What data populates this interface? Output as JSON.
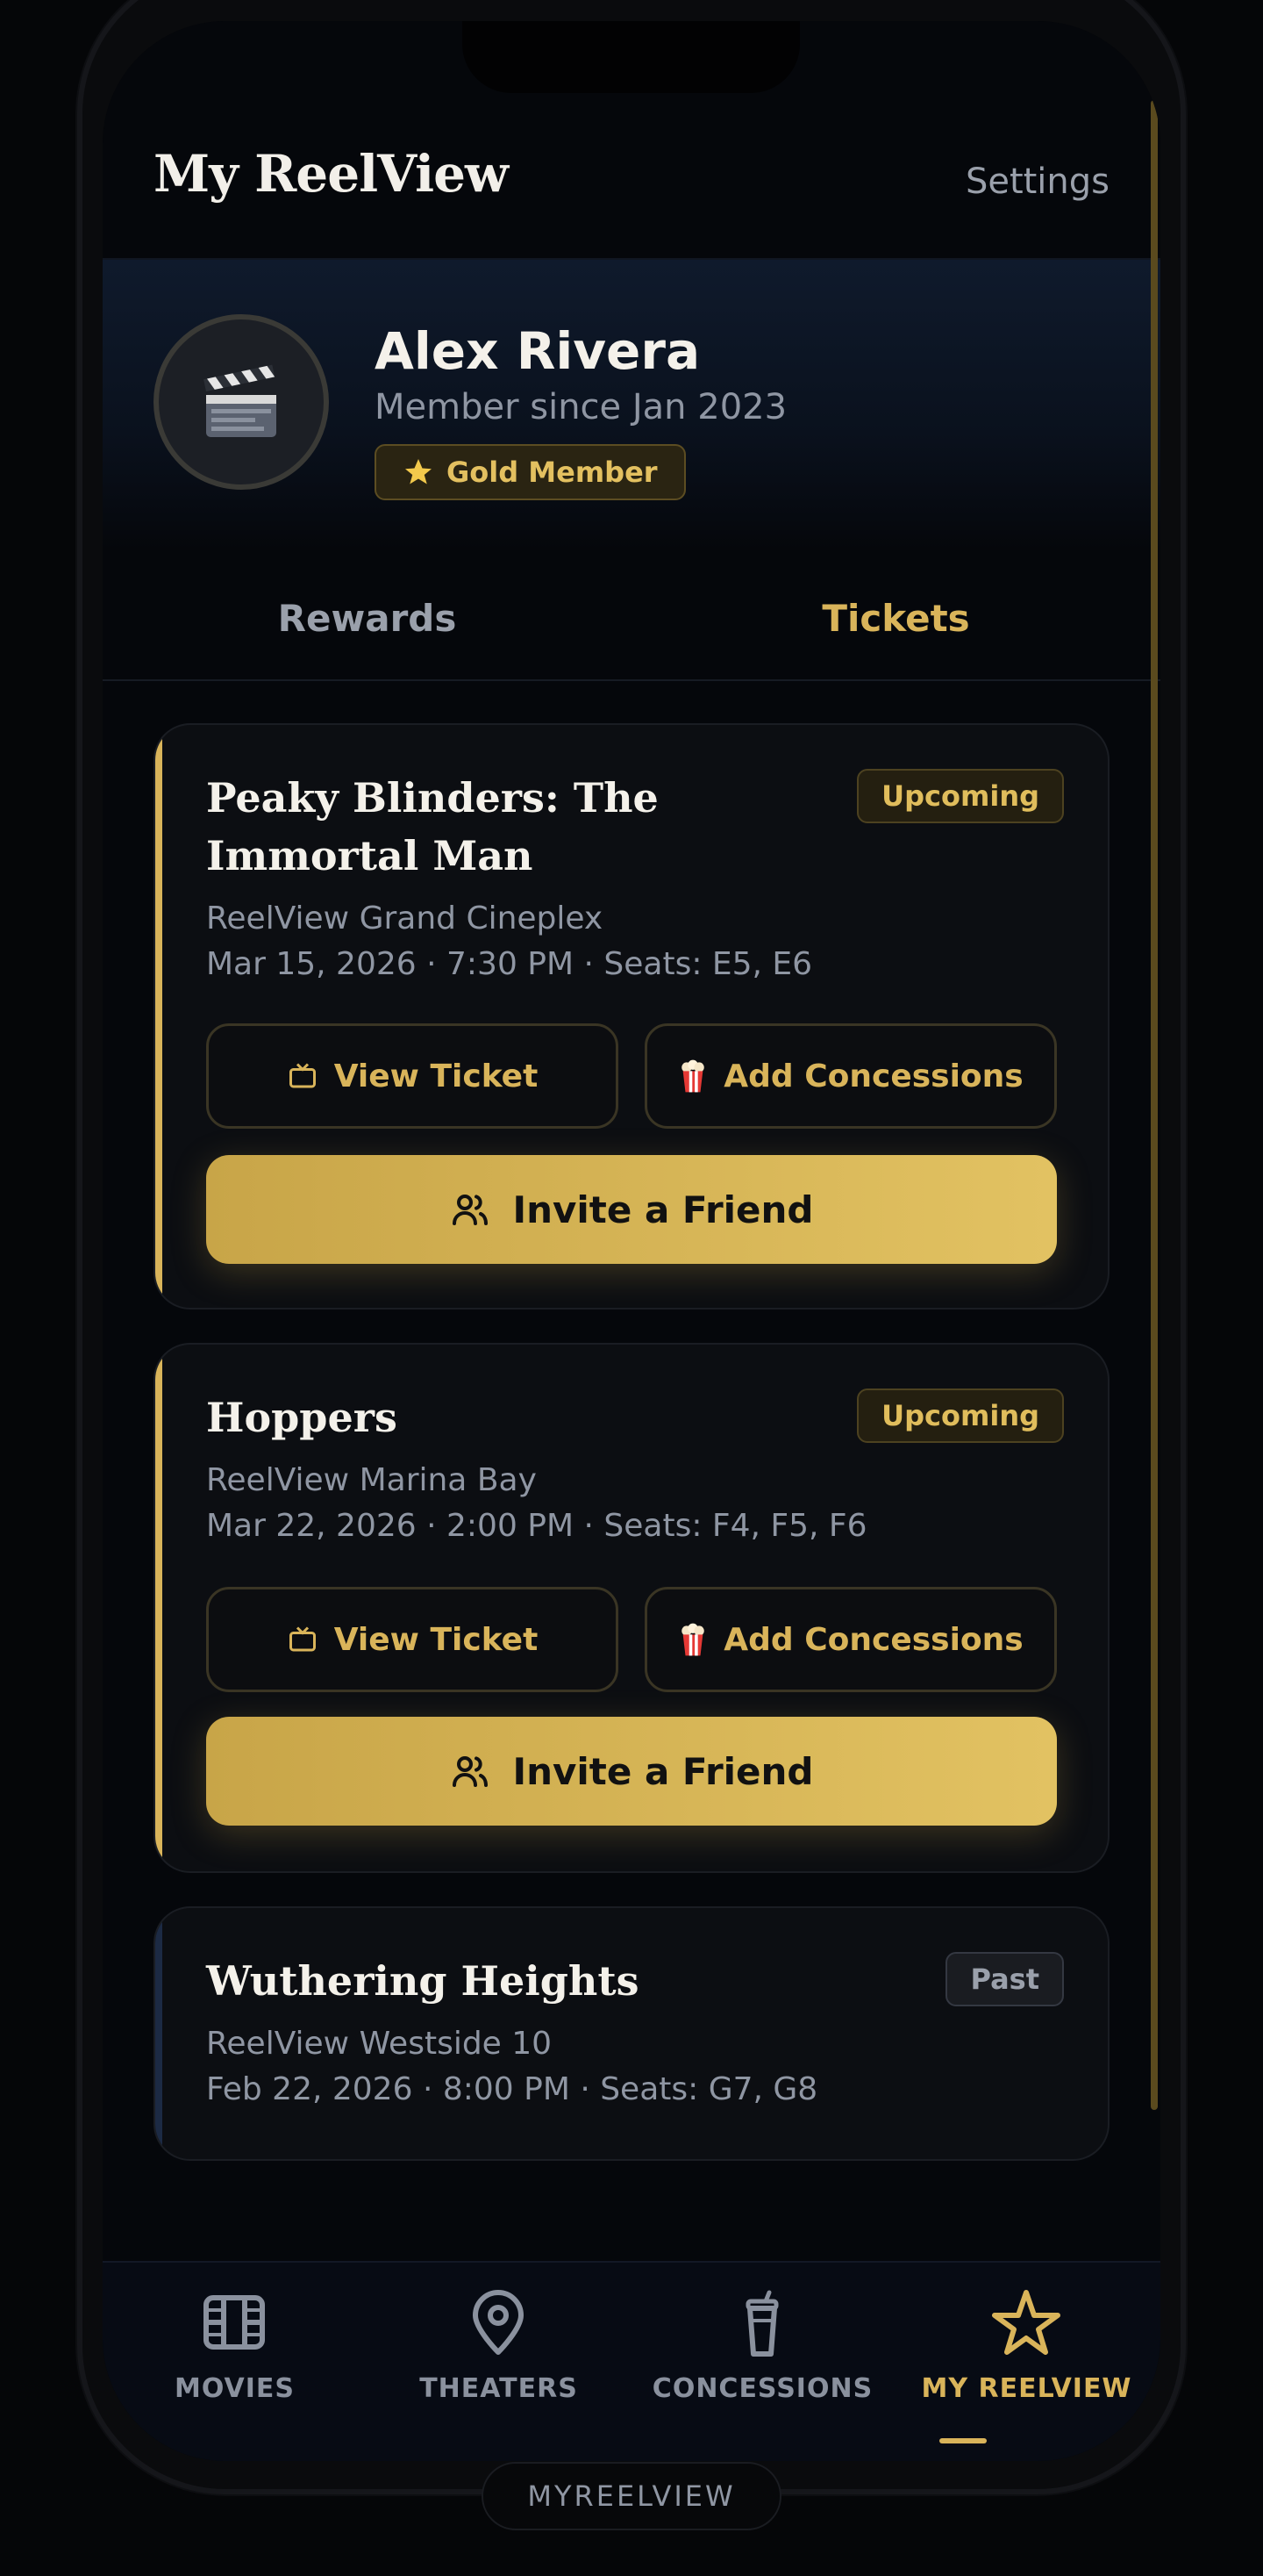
{
  "header": {
    "title": "My ReelView",
    "settings_label": "Settings"
  },
  "profile": {
    "name": "Alex Rivera",
    "member_since": "Member since Jan 2023",
    "badge": "Gold Member",
    "avatar_icon": "clapperboard-icon"
  },
  "tabs": [
    {
      "label": "Rewards",
      "active": false
    },
    {
      "label": "Tickets",
      "active": true
    }
  ],
  "tickets": [
    {
      "title": "Peaky Blinders: The Immortal Man",
      "status": "Upcoming",
      "theater": "ReelView Grand Cineplex",
      "meta": "Mar 15, 2026 · 7:30 PM · Seats: E5, E6",
      "view_ticket": "View Ticket",
      "add_concessions": "Add Concessions",
      "invite": "Invite a Friend"
    },
    {
      "title": "Hoppers",
      "status": "Upcoming",
      "theater": "ReelView Marina Bay",
      "meta": "Mar 22, 2026 · 2:00 PM · Seats: F4, F5, F6",
      "view_ticket": "View Ticket",
      "add_concessions": "Add Concessions",
      "invite": "Invite a Friend"
    },
    {
      "title": "Wuthering Heights",
      "status": "Past",
      "theater": "ReelView Westside 10",
      "meta": "Feb 22, 2026 · 8:00 PM · Seats: G7, G8"
    }
  ],
  "nav": [
    {
      "label": "MOVIES",
      "icon": "film-icon",
      "active": false
    },
    {
      "label": "THEATERS",
      "icon": "map-pin-icon",
      "active": false
    },
    {
      "label": "CONCESSIONS",
      "icon": "drink-cup-icon",
      "active": false
    },
    {
      "label": "MY REELVIEW",
      "icon": "star-icon",
      "active": true
    }
  ],
  "page_label": "MYREELVIEW",
  "colors": {
    "accent_gold": "#d9b45a",
    "background": "#05070b",
    "muted_text": "#8f96a3",
    "past_accent": "#1c2a44"
  }
}
